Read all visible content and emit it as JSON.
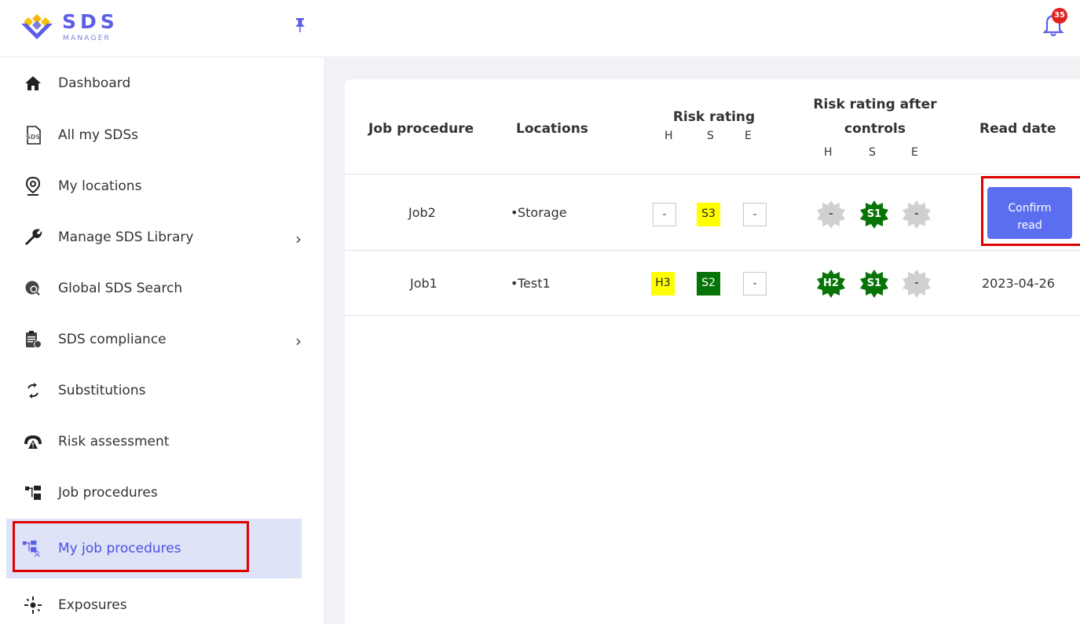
{
  "app": {
    "logo_title": "SDS",
    "logo_subtitle": "MANAGER",
    "notifications_count": "35"
  },
  "sidebar": {
    "items": [
      {
        "label": "Dashboard",
        "icon": "home-icon"
      },
      {
        "label": "All my SDSs",
        "icon": "sds-document-icon"
      },
      {
        "label": "My locations",
        "icon": "location-pin-icon"
      },
      {
        "label": "Manage SDS Library",
        "icon": "wrench-icon",
        "has_submenu": true
      },
      {
        "label": "Global SDS Search",
        "icon": "global-search-icon"
      },
      {
        "label": "SDS compliance",
        "icon": "clipboard-check-icon",
        "has_submenu": true
      },
      {
        "label": "Substitutions",
        "icon": "substitution-cycle-icon"
      },
      {
        "label": "Risk assessment",
        "icon": "risk-gauge-icon"
      },
      {
        "label": "Job procedures",
        "icon": "job-tree-icon"
      },
      {
        "label": "My job procedures",
        "icon": "my-job-tree-icon",
        "active": true
      },
      {
        "label": "Exposures",
        "icon": "exposure-icon"
      }
    ]
  },
  "table": {
    "headers": {
      "job_procedure": "Job procedure",
      "locations": "Locations",
      "risk_rating": "Risk rating",
      "risk_after_line1": "Risk rating after",
      "risk_after_line2": "controls",
      "read_date": "Read date"
    },
    "hse": [
      "H",
      "S",
      "E"
    ],
    "rows": [
      {
        "job": "Job2",
        "location": "Storage",
        "risk": {
          "h": "-",
          "s": "S3",
          "e": "-"
        },
        "after": {
          "h": "-",
          "s": "S1",
          "e": "-"
        },
        "read_date": "",
        "confirm_label_1": "Confirm",
        "confirm_label_2": "read"
      },
      {
        "job": "Job1",
        "location": "Test1",
        "risk": {
          "h": "H3",
          "s": "S2",
          "e": "-"
        },
        "after": {
          "h": "H2",
          "s": "S1",
          "e": "-"
        },
        "read_date": "2023-04-26"
      }
    ]
  },
  "colors": {
    "accent": "#5c6ef0",
    "risk_yellow": "#ffff00",
    "risk_green": "#077407",
    "neutral_gray": "#d0d0d0",
    "highlight_red": "#e00000"
  }
}
